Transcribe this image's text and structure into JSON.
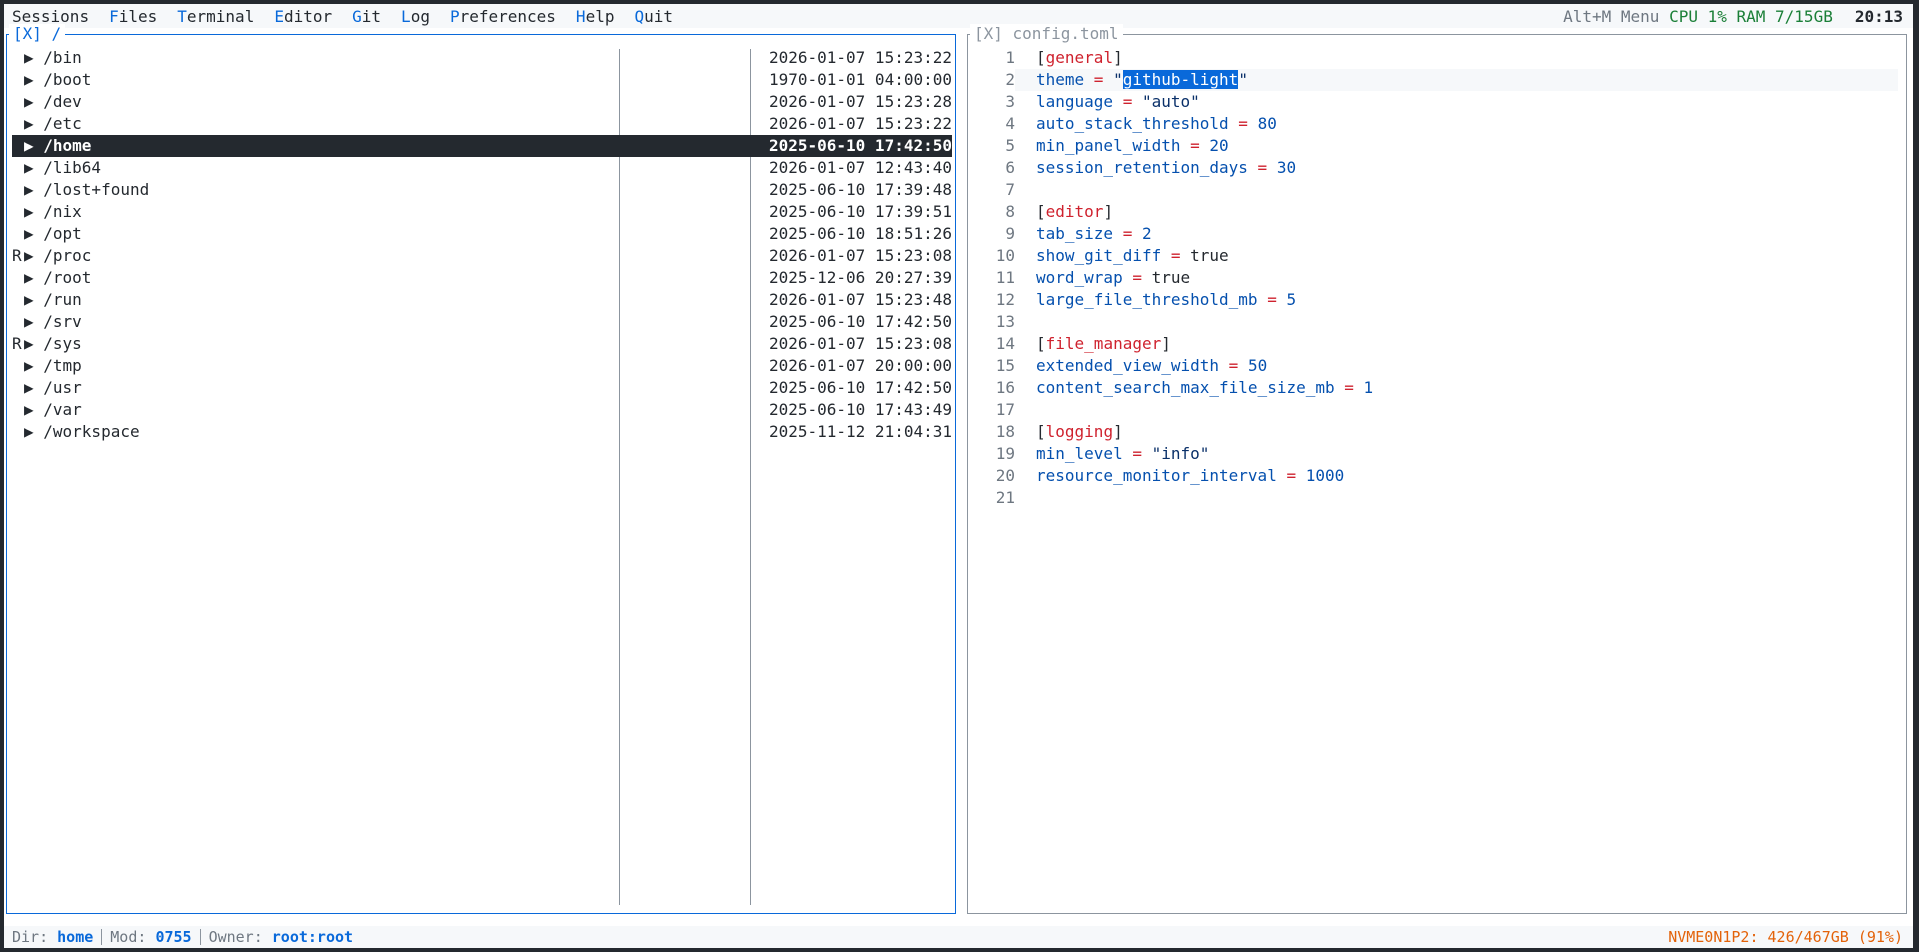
{
  "menu": {
    "items": [
      {
        "hk": "S",
        "rest": "essions",
        "hkColored": false
      },
      {
        "hk": "F",
        "rest": "iles"
      },
      {
        "hk": "T",
        "rest": "erminal"
      },
      {
        "hk": "E",
        "rest": "ditor"
      },
      {
        "hk": "G",
        "rest": "it"
      },
      {
        "hk": "L",
        "rest": "og"
      },
      {
        "hk": "P",
        "rest": "references"
      },
      {
        "hk": "H",
        "rest": "elp"
      },
      {
        "hk": "Q",
        "rest": "uit"
      }
    ],
    "hint": "Alt+M Menu",
    "cpu": "CPU 1%",
    "ram": "RAM 7/15GB",
    "clock": "20:13"
  },
  "files": {
    "title": "[X] /",
    "rows": [
      {
        "flag": "",
        "name": "/bin",
        "date": "2026-01-07 15:23:22"
      },
      {
        "flag": "",
        "name": "/boot",
        "date": "1970-01-01 04:00:00"
      },
      {
        "flag": "",
        "name": "/dev",
        "date": "2026-01-07 15:23:28"
      },
      {
        "flag": "",
        "name": "/etc",
        "date": "2026-01-07 15:23:22"
      },
      {
        "flag": "",
        "name": "/home",
        "date": "2025-06-10 17:42:50",
        "selected": true
      },
      {
        "flag": "",
        "name": "/lib64",
        "date": "2026-01-07 12:43:40"
      },
      {
        "flag": "",
        "name": "/lost+found",
        "date": "2025-06-10 17:39:48"
      },
      {
        "flag": "",
        "name": "/nix",
        "date": "2025-06-10 17:39:51"
      },
      {
        "flag": "",
        "name": "/opt",
        "date": "2025-06-10 18:51:26"
      },
      {
        "flag": "R",
        "name": "/proc",
        "date": "2026-01-07 15:23:08"
      },
      {
        "flag": "",
        "name": "/root",
        "date": "2025-12-06 20:27:39"
      },
      {
        "flag": "",
        "name": "/run",
        "date": "2026-01-07 15:23:48"
      },
      {
        "flag": "",
        "name": "/srv",
        "date": "2025-06-10 17:42:50"
      },
      {
        "flag": "R",
        "name": "/sys",
        "date": "2026-01-07 15:23:08"
      },
      {
        "flag": "",
        "name": "/tmp",
        "date": "2026-01-07 20:00:00"
      },
      {
        "flag": "",
        "name": "/usr",
        "date": "2025-06-10 17:42:50"
      },
      {
        "flag": "",
        "name": "/var",
        "date": "2025-06-10 17:43:49"
      },
      {
        "flag": "",
        "name": "/workspace",
        "date": "2025-11-12 21:04:31"
      }
    ]
  },
  "editor": {
    "title": "[X] config.toml",
    "lines": [
      {
        "t": "sec",
        "v": "general"
      },
      {
        "t": "kv",
        "k": "theme",
        "v": "\"github-light\"",
        "vt": "str",
        "cur": true,
        "selected": "github-light"
      },
      {
        "t": "kv",
        "k": "language",
        "v": "\"auto\"",
        "vt": "s"
      },
      {
        "t": "kv",
        "k": "auto_stack_threshold",
        "v": "80",
        "vt": "n"
      },
      {
        "t": "kv",
        "k": "min_panel_width",
        "v": "20",
        "vt": "n"
      },
      {
        "t": "kv",
        "k": "session_retention_days",
        "v": "30",
        "vt": "n"
      },
      {
        "t": "blank"
      },
      {
        "t": "sec",
        "v": "editor"
      },
      {
        "t": "kv",
        "k": "tab_size",
        "v": "2",
        "vt": "n"
      },
      {
        "t": "kv",
        "k": "show_git_diff",
        "v": "true",
        "vt": "b"
      },
      {
        "t": "kv",
        "k": "word_wrap",
        "v": "true",
        "vt": "b"
      },
      {
        "t": "kv",
        "k": "large_file_threshold_mb",
        "v": "5",
        "vt": "n"
      },
      {
        "t": "blank"
      },
      {
        "t": "sec",
        "v": "file_manager"
      },
      {
        "t": "kv",
        "k": "extended_view_width",
        "v": "50",
        "vt": "n"
      },
      {
        "t": "kv",
        "k": "content_search_max_file_size_mb",
        "v": "1",
        "vt": "n"
      },
      {
        "t": "blank"
      },
      {
        "t": "sec",
        "v": "logging"
      },
      {
        "t": "kv",
        "k": "min_level",
        "v": "\"info\"",
        "vt": "s"
      },
      {
        "t": "kv",
        "k": "resource_monitor_interval",
        "v": "1000",
        "vt": "n"
      },
      {
        "t": "blank"
      }
    ]
  },
  "status": {
    "dir_label": "Dir: ",
    "dir": "home",
    "mod_label": "Mod: ",
    "mod": "0755",
    "owner_label": "Owner: ",
    "owner": "root:root",
    "disk": "NVME0N1P2: 426/467GB (91%)"
  }
}
